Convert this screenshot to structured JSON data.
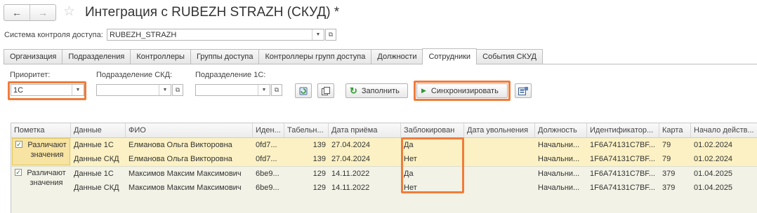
{
  "header": {
    "title": "Интеграция с RUBEZH STRAZH (СКУД) *",
    "back_glyph": "←",
    "forward_glyph": "→",
    "star_glyph": "☆"
  },
  "access_system": {
    "label": "Система контроля доступа:",
    "value": "RUBEZH_STRAZH"
  },
  "tabs": [
    {
      "label": "Организация"
    },
    {
      "label": "Подразделения"
    },
    {
      "label": "Контроллеры"
    },
    {
      "label": "Группы доступа"
    },
    {
      "label": "Контроллеры групп доступа"
    },
    {
      "label": "Должности"
    },
    {
      "label": "Сотрудники",
      "active": true
    },
    {
      "label": "События СКУД"
    }
  ],
  "filters": {
    "priority": {
      "label": "Приоритет:",
      "value": "1С"
    },
    "skd_department": {
      "label": "Подразделение СКД:",
      "value": ""
    },
    "c1_department": {
      "label": "Подразделение 1С:",
      "value": ""
    }
  },
  "buttons": {
    "fill": "Заполнить",
    "sync": "Синхронизировать"
  },
  "table": {
    "columns": [
      "Пометка",
      "Данные",
      "ФИО",
      "Иден...",
      "Табельн...",
      "Дата приёма",
      "Заблокирован",
      "Дата увольнения",
      "Должность",
      "Идентификатор...",
      "Карта",
      "Начало действ..."
    ],
    "groups": [
      {
        "checked": true,
        "mark": "Различают значения",
        "rows": [
          {
            "data": "Данные 1С",
            "fio": "Елманова Ольга Викторовна",
            "id": "0fd7...",
            "tab": "139",
            "hired": "27.04.2024",
            "blocked": "Да",
            "fired": "",
            "position": "Начальни...",
            "ident": "1F6A74131C7BF...",
            "card": "79",
            "start": "01.02.2024"
          },
          {
            "data": "Данные СКД",
            "fio": "Елманова Ольга Викторовна",
            "id": "0fd7...",
            "tab": "139",
            "hired": "27.04.2024",
            "blocked": "Нет",
            "fired": "",
            "position": "Начальни...",
            "ident": "1F6A74131C7BF...",
            "card": "79",
            "start": "01.02.2024"
          }
        ]
      },
      {
        "checked": true,
        "mark": "Различают значения",
        "rows": [
          {
            "data": "Данные 1С",
            "fio": "Максимов Максим Максимович",
            "id": "6be9...",
            "tab": "129",
            "hired": "14.11.2022",
            "blocked": "Да",
            "fired": "",
            "position": "Начальни...",
            "ident": "1F6A74131C7BF...",
            "card": "379",
            "start": "01.04.2025"
          },
          {
            "data": "Данные СКД",
            "fio": "Максимов Максим Максимович",
            "id": "6be9...",
            "tab": "129",
            "hired": "14.11.2022",
            "blocked": "Нет",
            "fired": "",
            "position": "Начальни...",
            "ident": "1F6A74131C7BF...",
            "card": "379",
            "start": "01.04.2025"
          }
        ]
      }
    ]
  },
  "colors": {
    "highlight": "#f07c3a",
    "selected_row": "#fbf1c4",
    "row_bg": "#f2f2e6",
    "sync_icon": "#2e9a2e",
    "refresh_icon": "#2e9a2e"
  }
}
